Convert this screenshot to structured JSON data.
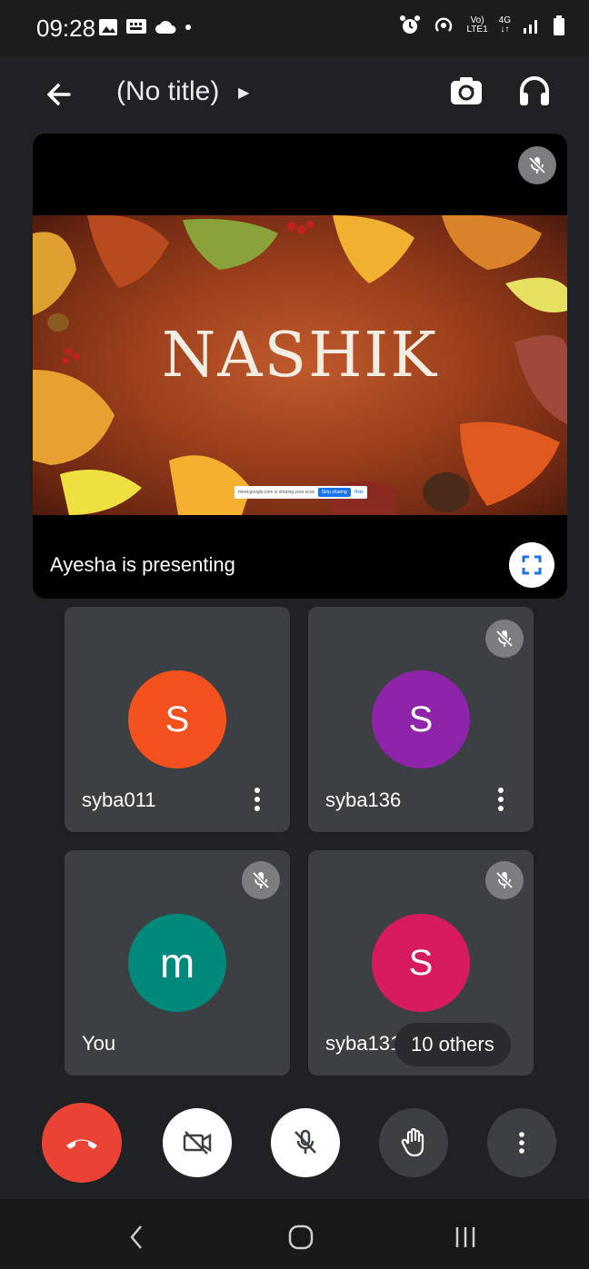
{
  "status_bar": {
    "time": "09:28",
    "network_top": "Vo)",
    "network_bottom": "LTE1",
    "data_top": "4G",
    "data_bottom": "↓↑"
  },
  "app_bar": {
    "title": "(No title)",
    "icons": [
      "back-arrow-icon",
      "caret-right-icon",
      "switch-camera-icon",
      "headset-icon"
    ]
  },
  "presentation": {
    "slide_title": "NASHIK",
    "share_bar_text": "meet.google.com is sharing your screen.",
    "share_bar_stop": "Stop sharing",
    "share_bar_hide": "Hide",
    "presenter_label": "Ayesha is presenting"
  },
  "participants": [
    {
      "name": "syba011",
      "initial": "S",
      "color": "#f4511e",
      "muted": false,
      "has_menu": true
    },
    {
      "name": "syba136",
      "initial": "S",
      "color": "#8e24aa",
      "muted": true,
      "has_menu": true
    },
    {
      "name": "You",
      "initial": "m",
      "color": "#00897b",
      "muted": true,
      "has_menu": false
    },
    {
      "name": "syba131",
      "initial": "S",
      "color": "#d81b60",
      "muted": true,
      "has_menu": false
    }
  ],
  "others_count_label": "10 others",
  "controls": [
    {
      "id": "end-call",
      "icon": "end-call-icon",
      "color": "#ea4335"
    },
    {
      "id": "camera",
      "icon": "camera-off-icon",
      "color": "#ffffff"
    },
    {
      "id": "microphone",
      "icon": "mic-off-icon",
      "color": "#ffffff"
    },
    {
      "id": "raise-hand",
      "icon": "raise-hand-icon",
      "color": "#3c4043"
    },
    {
      "id": "more",
      "icon": "more-vertical-icon",
      "color": "#3c4043"
    }
  ],
  "navigation": [
    "back-nav-icon",
    "home-nav-icon",
    "recents-nav-icon"
  ]
}
